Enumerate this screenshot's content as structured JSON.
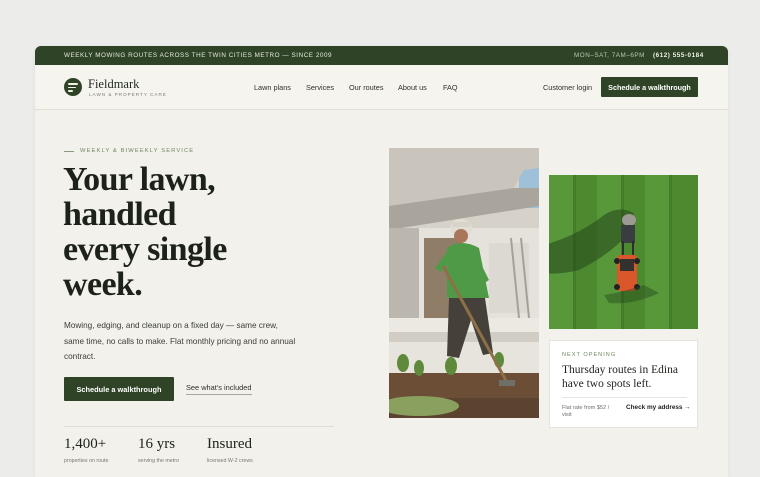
{
  "topbar": {
    "announcement": "WEEKLY MOWING ROUTES ACROSS THE TWIN CITIES METRO — SINCE 2009",
    "hours": "MON–SAT, 7AM–6PM",
    "phone": "(612) 555-0184"
  },
  "brand": {
    "name": "Fieldmark",
    "tagline": "LAWN & PROPERTY CARE"
  },
  "nav": {
    "links": [
      "Lawn plans",
      "Services",
      "Our routes",
      "About us",
      "FAQ"
    ],
    "login": "Customer login",
    "cta": "Schedule a walkthrough"
  },
  "hero": {
    "eyebrow": "WEEKLY & BIWEEKLY SERVICE",
    "headline_lines": [
      "Your lawn,",
      "handled",
      "every single",
      "week."
    ],
    "lede": "Mowing, edging, and cleanup on a fixed day — same crew, same time, no calls to make. Flat monthly pricing and no annual contract.",
    "primary_cta": "Schedule a walkthrough",
    "secondary_cta": "See what's included"
  },
  "stats": [
    {
      "value": "1,400+",
      "label": "properties on route"
    },
    {
      "value": "16 yrs",
      "label": "serving the metro"
    },
    {
      "value": "Insured",
      "label": "licensed W-2 crews"
    }
  ],
  "opening_card": {
    "kicker": "NEXT OPENING",
    "title": "Thursday routes in Edina have two spots left.",
    "fine_print": "Flat rate from $52 / visit",
    "cta": "Check my address →"
  },
  "colors": {
    "brand_green": "#2f4427",
    "page_bg": "#f3f1ec",
    "accent_text": "#6f8660"
  },
  "icons": {
    "logo": "logo-mark-icon"
  }
}
